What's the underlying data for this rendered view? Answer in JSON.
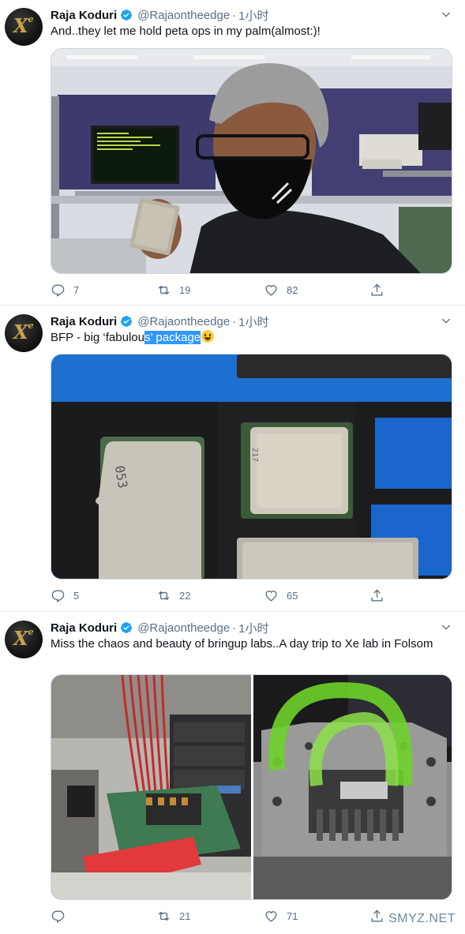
{
  "tweets": [
    {
      "name": "Raja Koduri",
      "handle": "@Rajaontheedge",
      "dot": "·",
      "time": "1小时",
      "text": "And..they let me hold peta ops in my palm(almost:)!",
      "replies": "7",
      "retweets": "19",
      "likes": "82"
    },
    {
      "name": "Raja Koduri",
      "handle": "@Rajaontheedge",
      "dot": "·",
      "time": "1小时",
      "text_plain": "BFP - big ‘fabulou",
      "text_highlight": "s’ package",
      "replies": "5",
      "retweets": "22",
      "likes": "65"
    },
    {
      "name": "Raja Koduri",
      "handle": "@Rajaontheedge",
      "dot": "·",
      "time": "1小时",
      "text": "Miss the chaos and beauty of bringup labs..A day trip to Xe lab in Folsom",
      "replies": "",
      "retweets": "21",
      "likes": "71"
    }
  ],
  "avatar_logo": "Xe",
  "watermark": "SMYZ.NET",
  "colors": {
    "verified": "#1da1f2",
    "muted": "#5b7083",
    "selection": "#3297fd"
  }
}
